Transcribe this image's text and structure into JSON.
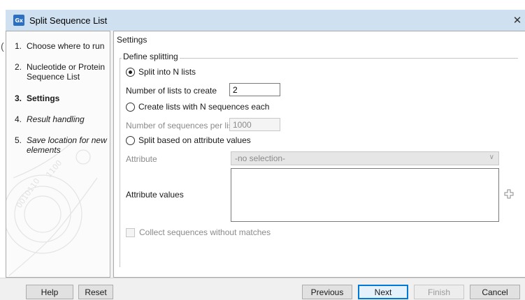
{
  "window": {
    "app_icon_text": "Gx",
    "title": "Split Sequence List",
    "close_glyph": "✕"
  },
  "sidebar": {
    "steps": [
      {
        "num": "1.",
        "label": "Choose where to run"
      },
      {
        "num": "2.",
        "label": "Nucleotide or Protein Sequence List"
      },
      {
        "num": "3.",
        "label": "Settings"
      },
      {
        "num": "4.",
        "label": "Result handling"
      },
      {
        "num": "5.",
        "label": "Save location for new elements"
      }
    ]
  },
  "main": {
    "section_label": "Settings",
    "group_title": "Define splitting",
    "options": {
      "split_n_lists": {
        "label": "Split into N lists",
        "checked": true
      },
      "n_sequences_each": {
        "label": "Create lists with N sequences each",
        "checked": false
      },
      "split_attribute": {
        "label": "Split based on attribute values",
        "checked": false
      }
    },
    "number_of_lists": {
      "label": "Number of lists to create",
      "value": "2"
    },
    "sequences_per_list": {
      "label": "Number of sequences per list",
      "value": "1000"
    },
    "attribute": {
      "label": "Attribute",
      "selected": "-no selection-"
    },
    "attribute_values": {
      "label": "Attribute values",
      "value": ""
    },
    "collect_unmatched": {
      "label": "Collect sequences without matches",
      "checked": false
    }
  },
  "buttons": {
    "help": "Help",
    "reset": "Reset",
    "previous": "Previous",
    "next": "Next",
    "finish": "Finish",
    "cancel": "Cancel"
  },
  "colors": {
    "titlebar": "#cfe0f1",
    "app_icon": "#2c70c2",
    "primary_button_border": "#0078d7"
  },
  "icons": {
    "close": "close-icon",
    "add": "plus-icon",
    "dropdown": "chevron-down-icon"
  }
}
